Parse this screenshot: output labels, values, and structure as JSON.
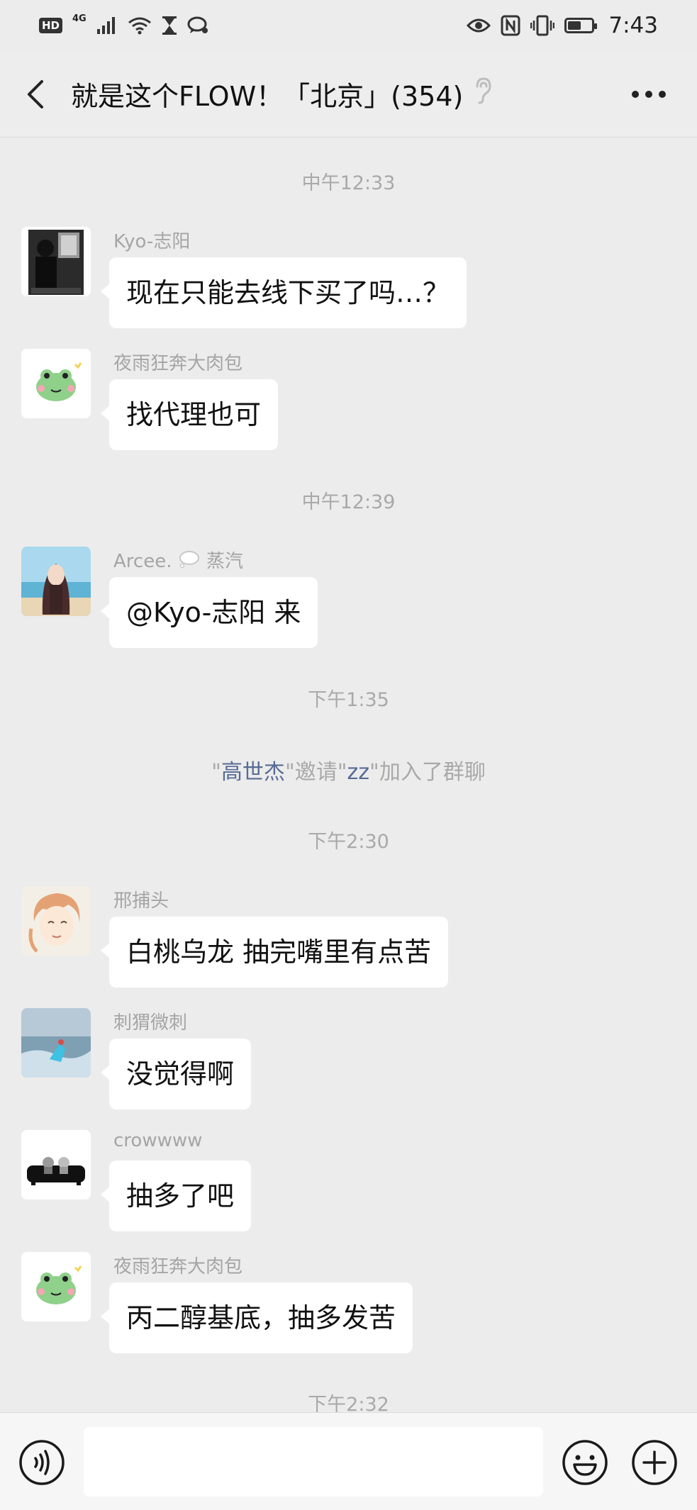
{
  "status_bar": {
    "hd": "HD",
    "network": "4G",
    "time": "7:43",
    "icons": [
      "signal-icon",
      "wifi-icon",
      "hourglass-icon",
      "chat-bubble-icon",
      "eye-icon",
      "nfc-icon",
      "vibrate-icon",
      "battery-icon"
    ],
    "battery_level": 0.55
  },
  "header": {
    "title": "就是这个FLOW！「北京」(354)",
    "icons": [
      "back-arrow-icon",
      "ear-icon",
      "more-dots-icon"
    ]
  },
  "chat": {
    "times": [
      "中午12:33",
      "中午12:39",
      "下午1:35",
      "下午2:30",
      "下午2:32"
    ],
    "system": {
      "q1": "\"",
      "inviter": "高世杰",
      "mid": "\"邀请\"",
      "invitee": "zz",
      "tail": "\"加入了群聊"
    },
    "messages": [
      {
        "sender": "Kyo-志阳",
        "text": "现在只能去线下买了吗…？"
      },
      {
        "sender": "夜雨狂奔大肉包",
        "text": "找代理也可"
      },
      {
        "sender": "Arcee.",
        "sender_tail": "蒸汽",
        "text": "@Kyo-志阳  来"
      },
      {
        "sender": "邢捕头",
        "text": "白桃乌龙 抽完嘴里有点苦"
      },
      {
        "sender": "刺猬微刺",
        "text": "没觉得啊"
      },
      {
        "sender": "crowwww",
        "text": "抽多了吧"
      },
      {
        "sender": "夜雨狂奔大肉包",
        "text": "丙二醇基底，抽多发苦"
      }
    ]
  },
  "input_bar": {
    "text_value": "",
    "icons": [
      "voice-icon",
      "emoji-icon",
      "plus-icon"
    ]
  },
  "colors": {
    "background": "#ececec",
    "bubble": "#ffffff",
    "link": "#576b95",
    "meta_text": "#a9a9a9"
  }
}
